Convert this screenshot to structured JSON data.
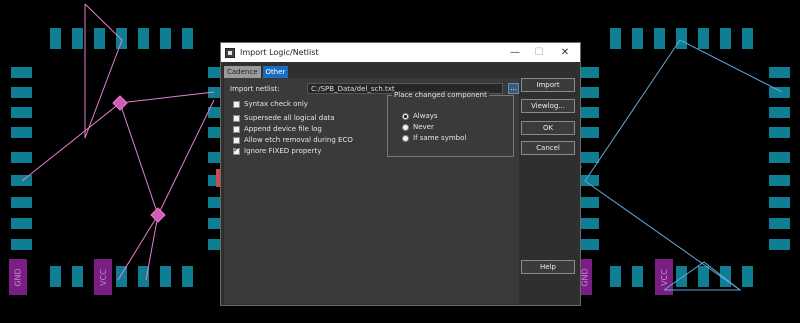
{
  "dialog": {
    "title": "Import Logic/Netlist",
    "tabs": [
      {
        "label": "Cadence",
        "active": false
      },
      {
        "label": "Other",
        "active": true
      }
    ],
    "import_netlist_label": "Import netlist:",
    "import_netlist_value": "C:/SPB_Data/del_sch.txt",
    "browse_label": "...",
    "options": [
      {
        "label": "Syntax check only",
        "checked": false
      },
      {
        "label": "Supersede all logical data",
        "checked": false
      },
      {
        "label": "Append device file log",
        "checked": false
      },
      {
        "label": "Allow etch removal during ECO",
        "checked": false
      },
      {
        "label": "Ignore FIXED property",
        "checked": true
      }
    ],
    "place_changed": {
      "title": "Place changed component",
      "choices": [
        {
          "label": "Always",
          "selected": true
        },
        {
          "label": "Never",
          "selected": false
        },
        {
          "label": "If same symbol",
          "selected": false
        }
      ]
    },
    "buttons": {
      "import": "Import",
      "viewlog": "Viewlog...",
      "ok": "OK",
      "cancel": "Cancel",
      "help": "Help"
    },
    "window_buttons": {
      "minimize": "—",
      "maximize": "☐",
      "close": "✕"
    }
  },
  "board": {
    "left_power_labels": [
      "GND",
      "VCC"
    ],
    "right_power_labels": [
      "GND",
      "VCC"
    ],
    "colors": {
      "pad": "#0f7d92",
      "power": "#7a1e84",
      "ratsnest_left": "#e77fd0",
      "ratsnest_right": "#62a9dc",
      "arrow": "#c94b4b",
      "accent": "#1a6dc4"
    }
  }
}
